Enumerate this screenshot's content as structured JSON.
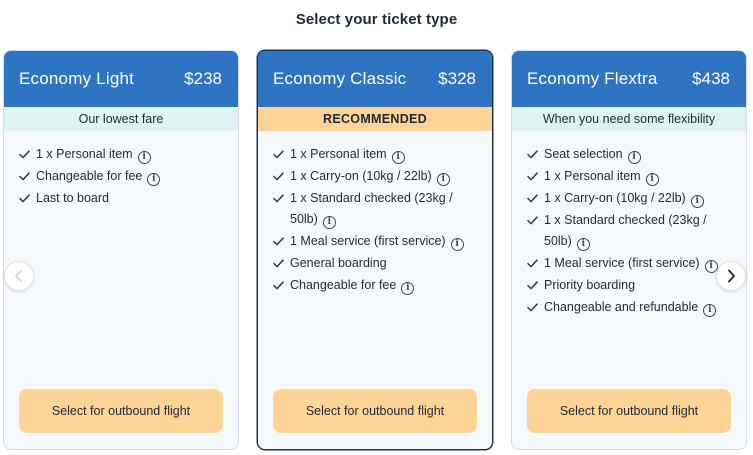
{
  "page": {
    "title": "Select your ticket type"
  },
  "cards": [
    {
      "name": "Economy Light",
      "price": "$238",
      "badge": "Our lowest fare",
      "features": [
        {
          "text": "1 x Personal item",
          "info": true
        },
        {
          "text": "Changeable for fee",
          "info": true
        },
        {
          "text": "Last to board",
          "info": false
        }
      ],
      "button": "Select for outbound flight"
    },
    {
      "name": "Economy Classic",
      "price": "$328",
      "badge": "RECOMMENDED",
      "features": [
        {
          "text": "1 x Personal item",
          "info": true
        },
        {
          "text": "1 x Carry-on (10kg / 22lb)",
          "info": true
        },
        {
          "text": "1 x Standard checked (23kg / 50lb)",
          "info": true
        },
        {
          "text": "1 Meal service (first service)",
          "info": true
        },
        {
          "text": "General boarding",
          "info": false
        },
        {
          "text": "Changeable for fee",
          "info": true
        }
      ],
      "button": "Select for outbound flight"
    },
    {
      "name": "Economy Flextra",
      "price": "$438",
      "badge": "When you need some flexibility",
      "features": [
        {
          "text": "Seat selection",
          "info": true
        },
        {
          "text": "1 x Personal item",
          "info": true
        },
        {
          "text": "1 x Carry-on (10kg / 22lb)",
          "info": true
        },
        {
          "text": "1 x Standard checked (23kg / 50lb)",
          "info": true
        },
        {
          "text": "1 Meal service (first service)",
          "info": true
        },
        {
          "text": "Priority boarding",
          "info": false
        },
        {
          "text": "Changeable and refundable",
          "info": true
        }
      ],
      "button": "Select for outbound flight"
    }
  ],
  "info_glyph": "i",
  "colors": {
    "header_blue": "#2f73c3",
    "recommended_badge": "#fdd496",
    "info_badge": "#dff3f1",
    "button": "#fdd496",
    "selected_border": "#1f3552"
  }
}
